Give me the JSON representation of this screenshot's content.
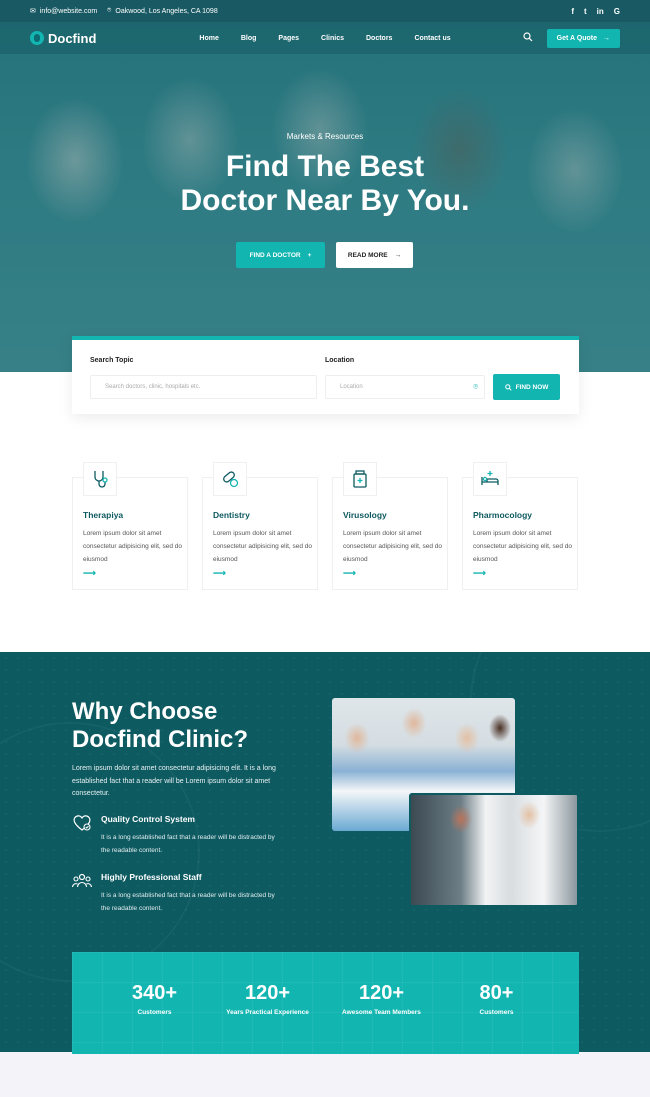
{
  "topbar": {
    "email": "info@website.com",
    "address": "Oakwood, Los Angeles, CA 1098",
    "social": [
      "f",
      "t",
      "in",
      "G"
    ]
  },
  "nav": {
    "logo": "Docfind",
    "items": [
      "Home",
      "Blog",
      "Pages",
      "Clinics",
      "Doctors",
      "Contact us"
    ],
    "quote_button": "Get A Quote"
  },
  "hero": {
    "subtitle": "Markets & Resources",
    "title_line1": "Find The Best",
    "title_line2": "Doctor Near By You.",
    "primary_button": "FIND A DOCTOR",
    "secondary_button": "READ MORE"
  },
  "search": {
    "topic_label": "Search Topic",
    "topic_placeholder": "Search doctors, clinic, hospitals etc.",
    "location_label": "Location",
    "location_placeholder": "Location",
    "button": "FIND NOW"
  },
  "services": [
    {
      "title": "Therapiya",
      "text": "Lorem ipsum dolor sit amet consectetur adipisicing elit, sed do eiusmod",
      "icon": "stethoscope-icon"
    },
    {
      "title": "Dentistry",
      "text": "Lorem ipsum dolor sit amet consectetur adipisicing elit, sed do eiusmod",
      "icon": "pills-icon"
    },
    {
      "title": "Virusology",
      "text": "Lorem ipsum dolor sit amet consectetur adipisicing elit, sed do eiusmod",
      "icon": "medicine-bottle-icon"
    },
    {
      "title": "Pharmocology",
      "text": "Lorem ipsum dolor sit amet consectetur adipisicing elit, sed do eiusmod",
      "icon": "hospital-bed-icon"
    }
  ],
  "why": {
    "title_line1": "Why Choose",
    "title_line2": "Docfind Clinic?",
    "description": "Lorem ipsum dolor sit amet consectetur adipisicing elit. It is a long established fact that a reader will be Lorem ipsum dolor sit amet consectetur.",
    "features": [
      {
        "title": "Quality Control System",
        "text": "It is a long established fact that a reader will be distracted by the readable content.",
        "icon": "heart-check-icon"
      },
      {
        "title": "Highly Professional Staff",
        "text": "It is a long established fact that a reader will be distracted by the readable content.",
        "icon": "team-icon"
      }
    ]
  },
  "stats": [
    {
      "number": "340+",
      "label": "Customers"
    },
    {
      "number": "120+",
      "label": "Years Practical Experience"
    },
    {
      "number": "120+",
      "label": "Awesome Team Members"
    },
    {
      "number": "80+",
      "label": "Customers"
    }
  ],
  "colors": {
    "accent": "#13b5b1",
    "dark_teal": "#0d5a61"
  }
}
